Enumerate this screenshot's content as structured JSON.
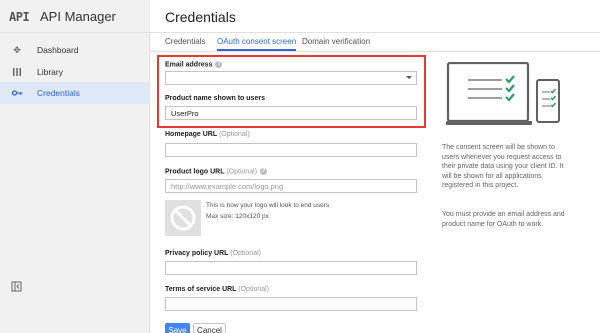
{
  "app": {
    "logo_text": "API",
    "title": "API Manager"
  },
  "page": {
    "title": "Credentials"
  },
  "sidebar": {
    "items": [
      {
        "label": "Dashboard",
        "icon": "dashboard-icon"
      },
      {
        "label": "Library",
        "icon": "library-icon"
      },
      {
        "label": "Credentials",
        "icon": "key-icon",
        "active": true
      }
    ]
  },
  "tabs": [
    {
      "label": "Credentials"
    },
    {
      "label": "OAuth consent screen",
      "active": true
    },
    {
      "label": "Domain verification"
    }
  ],
  "form": {
    "email": {
      "label": "Email address",
      "value": ""
    },
    "product_name": {
      "label": "Product name shown to users",
      "value": "UserPro"
    },
    "homepage": {
      "label": "Homepage URL",
      "optional": "(Optional)",
      "value": ""
    },
    "logo_url": {
      "label": "Product logo URL",
      "optional": "(Optional)",
      "placeholder": "http://www.example.com/logo.png"
    },
    "logo_note": "This is how your logo will look to end users",
    "logo_size": "Max size: 120x120 px",
    "privacy": {
      "label": "Privacy policy URL",
      "optional": "(Optional)",
      "value": ""
    },
    "terms": {
      "label": "Terms of service URL",
      "optional": "(Optional)",
      "value": ""
    },
    "save_label": "Save",
    "cancel_label": "Cancel"
  },
  "info": {
    "paragraph1": "The consent screen will be shown to users whenever you request access to their private data using your client ID. It will be shown for all applications registered in this project.",
    "paragraph2": "You must provide an email address and product name for OAuth to work."
  },
  "colors": {
    "accent": "#3367d6",
    "primary_button": "#4285f4",
    "highlight": "#e53935",
    "check": "#2e9c6a"
  }
}
